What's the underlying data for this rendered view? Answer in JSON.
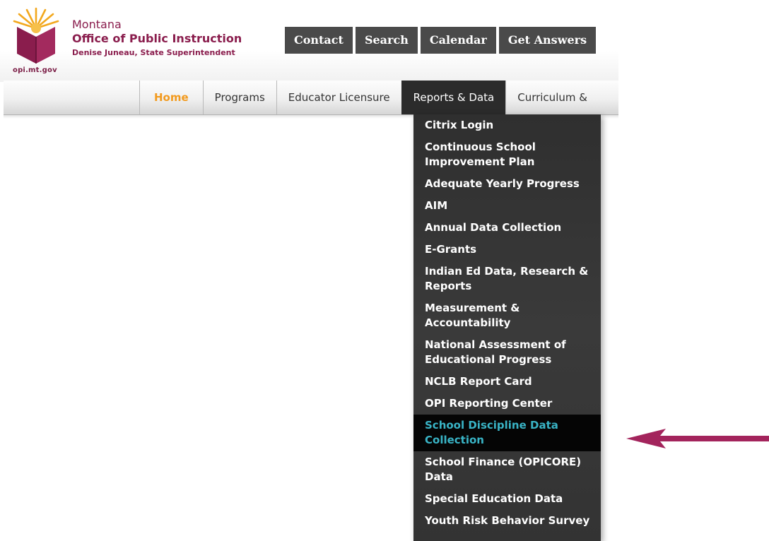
{
  "header": {
    "site_url": "opi.mt.gov",
    "state": "Montana",
    "office": "Office of Public Instruction",
    "subtitle": "Denise Juneau, State Superintendent",
    "brand_color": "#8a1d4d",
    "utility_links": [
      "Contact",
      "Search",
      "Calendar",
      "Get Answers"
    ]
  },
  "nav": {
    "items": [
      {
        "label": "Home",
        "state": "home"
      },
      {
        "label": "Programs",
        "state": "normal"
      },
      {
        "label": "Educator Licensure",
        "state": "normal"
      },
      {
        "label": "Reports & Data",
        "state": "active"
      },
      {
        "label": "Curriculum &",
        "state": "clipped"
      }
    ],
    "home_color": "#f29a1e"
  },
  "dropdown": {
    "items": [
      "Citrix Login",
      "Continuous School Improvement Plan",
      "Adequate Yearly Progress",
      "AIM",
      "Annual Data Collection",
      "E-Grants",
      "Indian Ed Data, Research & Reports",
      "Measurement & Accountability",
      "National Assessment of Educational Progress",
      "NCLB Report Card",
      "OPI Reporting Center",
      "School Discipline Data Collection",
      "School Finance (OPICORE) Data",
      "Special Education Data",
      "Youth Risk Behavior Survey"
    ],
    "highlighted": "School Discipline Data Collection",
    "highlight_color": "#39b4c6"
  },
  "annotation": {
    "arrow_color": "#a3245c",
    "points_to": "School Discipline Data Collection"
  }
}
